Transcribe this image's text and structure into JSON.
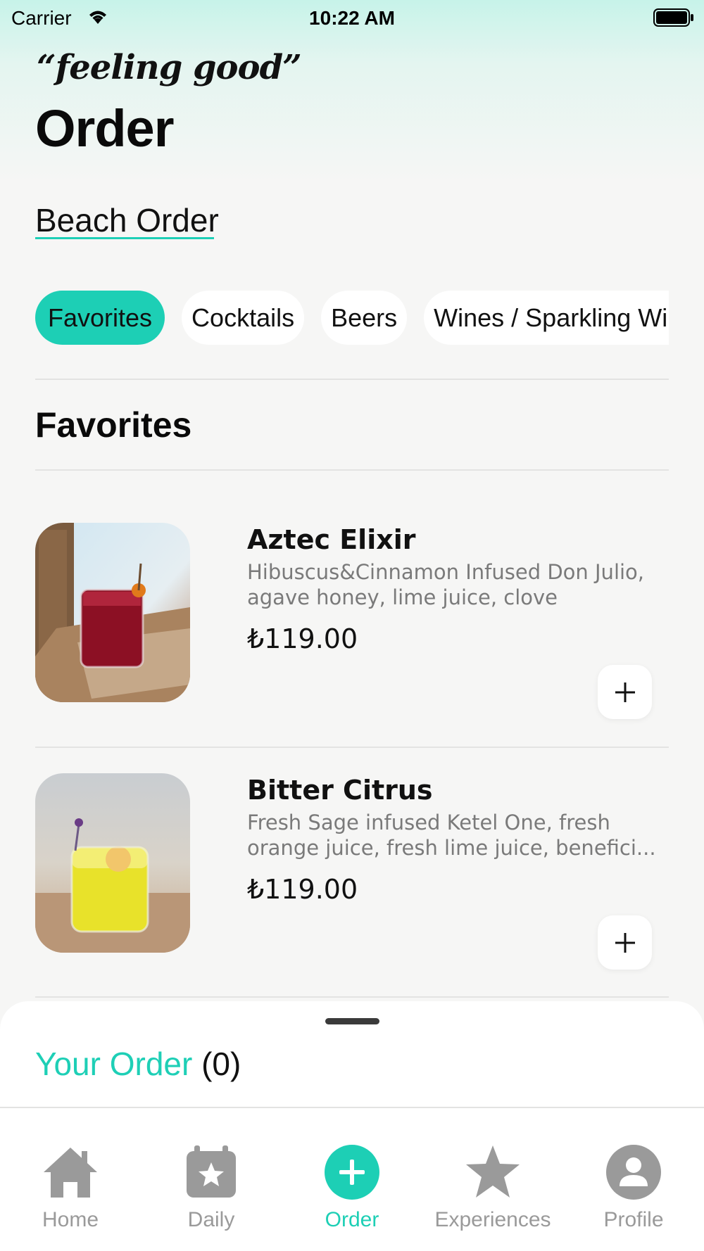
{
  "status_bar": {
    "carrier": "Carrier",
    "time": "10:22 AM"
  },
  "header": {
    "brand": "“feeling good”",
    "title": "Order",
    "order_name": "Beach Order"
  },
  "categories": [
    {
      "label": "Favorites",
      "active": true
    },
    {
      "label": "Cocktails",
      "active": false
    },
    {
      "label": "Beers",
      "active": false
    },
    {
      "label": "Wines / Sparkling Wines",
      "active": false
    }
  ],
  "section": {
    "title": "Favorites"
  },
  "products": [
    {
      "name": "Aztec Elixir",
      "description_line1": "Hibuscus&Cinnamon Infused Don Julio,",
      "description_line2": "agave honey, lime juice, clove",
      "price": "₺119.00",
      "add_icon": "plus-icon"
    },
    {
      "name": "Bitter Citrus",
      "description_line1": "Fresh Sage infused Ketel One, fresh",
      "description_line2": "orange juice, fresh lime juice, benefici...",
      "price": "₺119.00",
      "add_icon": "plus-icon"
    }
  ],
  "order_sheet": {
    "title": "Your Order",
    "count": "(0)"
  },
  "tabs": [
    {
      "label": "Home",
      "icon": "home-icon",
      "active": false
    },
    {
      "label": "Daily",
      "icon": "calendar-star-icon",
      "active": false
    },
    {
      "label": "Order",
      "icon": "plus-circle-icon",
      "active": true
    },
    {
      "label": "Experiences",
      "icon": "star-icon",
      "active": false
    },
    {
      "label": "Profile",
      "icon": "user-icon",
      "active": false
    }
  ],
  "colors": {
    "accent": "#1dcfb5",
    "background": "#f6f6f5",
    "inactive_tab": "#9a9a9a"
  }
}
